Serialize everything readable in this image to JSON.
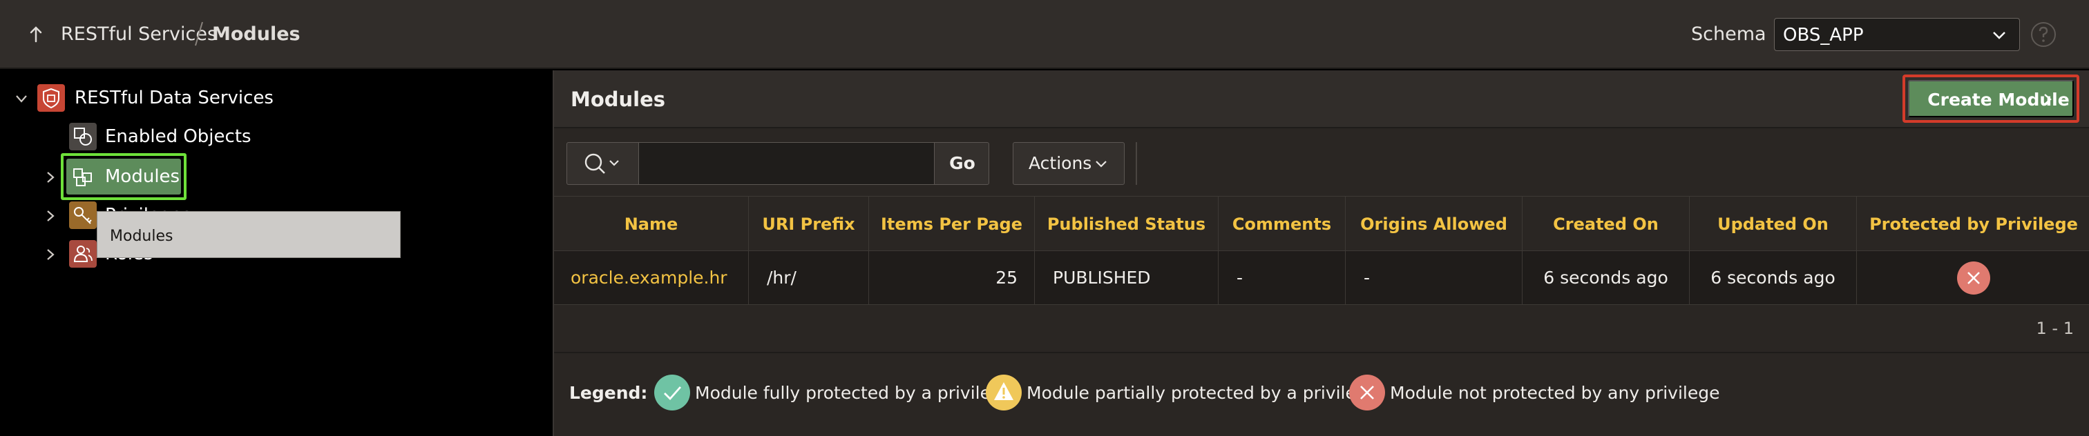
{
  "header": {
    "breadcrumb": [
      "RESTful Services",
      "Modules"
    ],
    "schema_label": "Schema",
    "schema_value": "OBS_APP"
  },
  "tree": {
    "root": "RESTful Data Services",
    "items": [
      {
        "label": "Enabled Objects",
        "icon": "enabled-objects-icon"
      },
      {
        "label": "Modules",
        "icon": "modules-icon",
        "selected": true
      },
      {
        "label": "Privileges",
        "icon": "key-icon"
      },
      {
        "label": "Roles",
        "icon": "roles-icon"
      }
    ],
    "tooltip": "Modules"
  },
  "main": {
    "title": "Modules",
    "create_button": "Create Module",
    "search": {
      "placeholder": "",
      "go_label": "Go"
    },
    "actions_label": "Actions"
  },
  "table": {
    "columns": [
      "Name",
      "URI Prefix",
      "Items Per Page",
      "Published Status",
      "Comments",
      "Origins Allowed",
      "Created On",
      "Updated On",
      "Protected by Privilege"
    ],
    "rows": [
      {
        "name": "oracle.example.hr",
        "uri_prefix": "/hr/",
        "items_per_page": "25",
        "published_status": "PUBLISHED",
        "comments": "-",
        "origins_allowed": "-",
        "created_on": "6 seconds ago",
        "updated_on": "6 seconds ago",
        "protected": "not-protected-icon"
      }
    ],
    "pagination": "1 - 1"
  },
  "legend": {
    "title": "Legend:",
    "items": [
      {
        "text": "Module fully protected by a privilege",
        "icon": "fully-protected-icon",
        "color": "#6fc3a4"
      },
      {
        "text": "Module partially protected by a privilege",
        "icon": "partially-protected-icon",
        "color": "#f0c85a"
      },
      {
        "text": "Module not protected by any privilege",
        "icon": "not-protected-icon",
        "color": "#e07a6f"
      }
    ]
  },
  "colors": {
    "accent_green": "#5d8c5b",
    "header_yellow": "#f3c343",
    "highlight_green": "#6ee13a",
    "highlight_red": "#d43b2a"
  }
}
